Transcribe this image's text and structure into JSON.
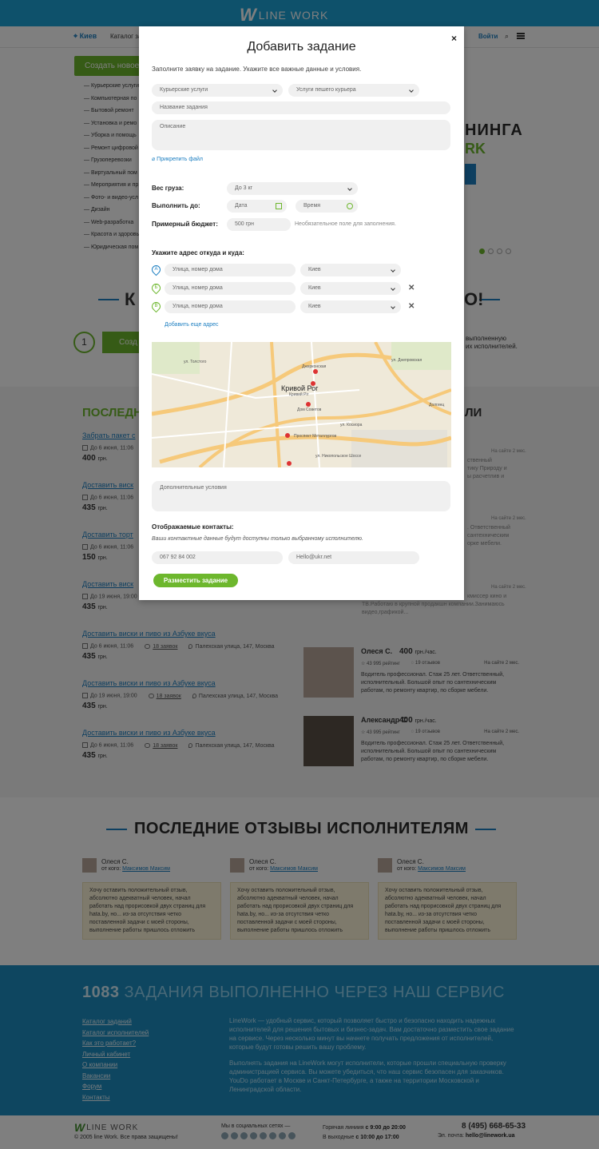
{
  "header": {
    "logo_mark": "W",
    "logo_text": "LINE WORK",
    "city": "Киев",
    "catalog_link": "Каталог за",
    "login": "Войти"
  },
  "sidebar": {
    "create_button": "Создать новое",
    "categories": [
      "Курьерские услуги",
      "Компьютерная по",
      "Бытовой ремонт",
      "Установка и ремо",
      "Уборка и помощь",
      "Ремонт цифровой",
      "Грузоперевозки",
      "Виртуальный пом",
      "Мероприятия и пр",
      "Фото- и видео-усл",
      "Дизайн",
      "Web-разработка",
      "Красота и здоровь",
      "Юридическая пом"
    ]
  },
  "promo": {
    "line1": "НИНГА",
    "line2": "RK"
  },
  "how": {
    "left": "К",
    "right": "О!",
    "step_num": "1",
    "step_button": "Созд",
    "step_text": "выполненную\nих исполнителей."
  },
  "tasks_section": {
    "title": "ПОСЛЕДН",
    "items": [
      {
        "title": "Забрать пакет с",
        "date": "До 6 июня, 11:06",
        "bids": "",
        "address": "",
        "price": "400",
        "unit": "грн."
      },
      {
        "title": "Доставить виск",
        "date": "До 6 июня, 11:06",
        "bids": "",
        "address": "",
        "price": "435",
        "unit": "грн."
      },
      {
        "title": "Доставить торт",
        "date": "До 6 июня, 11:06",
        "bids": "",
        "address": "",
        "price": "150",
        "unit": "грн."
      },
      {
        "title": "Доставить виск",
        "date": "До 19 июня, 19:00",
        "bids": "",
        "address": "",
        "price": "435",
        "unit": "грн."
      },
      {
        "title": "Доставить виски и пиво из Азбуке вкуса",
        "date": "До 6 июня, 11:06",
        "bids": "18 заявок",
        "address": "Палехская улица, 147, Москва",
        "price": "435",
        "unit": "грн."
      },
      {
        "title": "Доставить виски и пиво из Азбуке вкуса",
        "date": "До 19 июня, 19:00",
        "bids": "18 заявок",
        "address": "Палехская улица, 147, Москва",
        "price": "435",
        "unit": "грн."
      },
      {
        "title": "Доставить виски и пиво из Азбуке вкуса",
        "date": "До 6 июня, 11:06",
        "bids": "18 заявок",
        "address": "Палехская улица, 147, Москва",
        "price": "435",
        "unit": "грн."
      }
    ]
  },
  "performers_section": {
    "title": "ЛИ",
    "fragments": [
      {
        "ago": "На сайте 2 мес.",
        "text": "ственный\nтику Природу и\nы расчетлив и"
      },
      {
        "ago": "На сайте 2 мес.",
        "text": ". Ответственный\nсантехническим\nорке мебели."
      },
      {
        "ago": "На сайте 2 мес.",
        "text": "кмиссер кино и\nТВ.Работаю в крупной продакшн компании.Занимаюсь\nвидео,графикой..."
      }
    ],
    "items": [
      {
        "name": "Олеся С.",
        "rate": "400",
        "unit": "грн./час.",
        "rating": "43 995 рейтинг",
        "reviews": "19 отзывов",
        "ago": "На сайте 2 мес.",
        "desc": "Водитель профессионал. Стаж 25 лет. Ответственный, исполнительный. Большой опыт по сантехническим работам, по ремонту квартир, по сборке мебели."
      },
      {
        "name": "Александр С",
        "rate": "400",
        "unit": "грн./час.",
        "rating": "43 995 рейтинг",
        "reviews": "19 отзывов",
        "ago": "На сайте 2 мес.",
        "desc": "Водитель профессионал. Стаж 25 лет. Ответственный, исполнительный. Большой опыт по сантехническим работам, по ремонту квартир, по сборке мебели."
      }
    ]
  },
  "reviews": {
    "title": "ПОСЛЕДНИЕ ОТЗЫВЫ ИСПОЛНИТЕЛЯМ",
    "items": [
      {
        "name": "Олеся С.",
        "from_label": "от кого:",
        "from": "Максимов Максим",
        "text": "Хочу оставить положительный отзыв, абсолютно адекватный человек, начал работать над прорисовкой двух страниц для hata.by, но... из-за отсутствия четко поставленной задачи с моей стороны, выполнение работы пришлось отложить"
      },
      {
        "name": "Олеся С.",
        "from_label": "от кого:",
        "from": "Максимов Максим",
        "text": "Хочу оставить положительный отзыв, абсолютно адекватный человек, начал работать над прорисовкой двух страниц для hata.by, но... из-за отсутствия четко поставленной задачи с моей стороны, выполнение работы пришлось отложить"
      },
      {
        "name": "Олеся С.",
        "from_label": "от кого:",
        "from": "Максимов Максим",
        "text": "Хочу оставить положительный отзыв, абсолютно адекватный человек, начал работать над прорисовкой двух страниц для hata.by, но... из-за отсутствия четко поставленной задачи с моей стороны, выполнение работы пришлось отложить"
      }
    ]
  },
  "footer": {
    "count": "1083",
    "count_text": " ЗАДАНИЯ ВЫПОЛНЕННО ЧЕРЕЗ НАШ СЕРВИС",
    "links": [
      "Каталог заданий",
      "Каталог исполнителей",
      "Как это работает?",
      "Личный кабинет",
      "О компании",
      "Вакансии",
      "Форум",
      "Контакты"
    ],
    "text1": "LineWork — удобный сервис, который позволяет быстро и безопасно находить надежных исполнителей для решения бытовых и бизнес-задач. Вам достаточно разместить свое задание на сервисе. Через несколько минут вы начнете получать предложения от исполнителей, которые будут готовы решить вашу проблему.",
    "text2": "Выполнять задания на LineWork могут исполнители, которые прошли специальную проверку администрацией сервиса. Вы можете убедиться, что наш сервис безопасен для заказчиков. YouDo работает в Москве и Санкт-Петербурге, а также на территории Московской и Ленинградской области.",
    "copyright": "© 2005 line Work. Все права защищены!",
    "social_label": "Мы в социальных сетях —",
    "hotline_label": "Горячая линиия",
    "hotline_hours": "с 9:00 до 20:00",
    "weekend_label": "В выходные",
    "weekend_hours": "с 10:00 до 17:00",
    "phone": "8 (495) 668-65-33",
    "email_label": "Эл. почта:",
    "email": "hello@linework.ua"
  },
  "modal": {
    "close": "×",
    "title": "Добавить задание",
    "subtitle": "Заполните заявку на задание. Укажите все важные данные и условия.",
    "category": "Курьерские услуги",
    "subcategory": "Услуги пешего курьера",
    "name_placeholder": "Название задания",
    "desc_placeholder": "Описание",
    "attach": "Прикрепить файл",
    "weight_label": "Вес груза:",
    "weight_value": "До 3 кг",
    "deadline_label": "Выполнить до:",
    "date_placeholder": "Дата",
    "time_placeholder": "Время",
    "budget_label": "Примерный бюджет:",
    "budget_value": "500 грн",
    "budget_hint": "Необязательное поле для заполнения.",
    "address_label": "Укажите адрес откуда и куда:",
    "addresses": [
      {
        "marker": "А",
        "placeholder": "Улица, номер дома",
        "city": "Киев"
      },
      {
        "marker": "Б",
        "placeholder": "Улица, номер дома",
        "city": "Киев"
      },
      {
        "marker": "В",
        "placeholder": "Улица, номер дома",
        "city": "Киев"
      }
    ],
    "remove": "✕",
    "add_address": "Добавить еще адрес",
    "map": {
      "city": "Кривой Рог",
      "labels": [
        "ул. Толстого",
        "Джерконская",
        "Кривий Ріг",
        "Дом Советов",
        "Проспект Металлургов",
        "ул. Косиора",
        "ул. Никопольское Шоссе",
        "Долгинц",
        "ул. Днепровская"
      ]
    },
    "extra_placeholder": "Дополнительные условия",
    "contacts_label": "Отображаемые контакты:",
    "contacts_hint": "Ваши контактные данные будут  доступны только выбранному исполнителю.",
    "phone_value": "067 92 84 002",
    "email_value": "Hello@ukr.net",
    "submit": "Разместить задание"
  }
}
